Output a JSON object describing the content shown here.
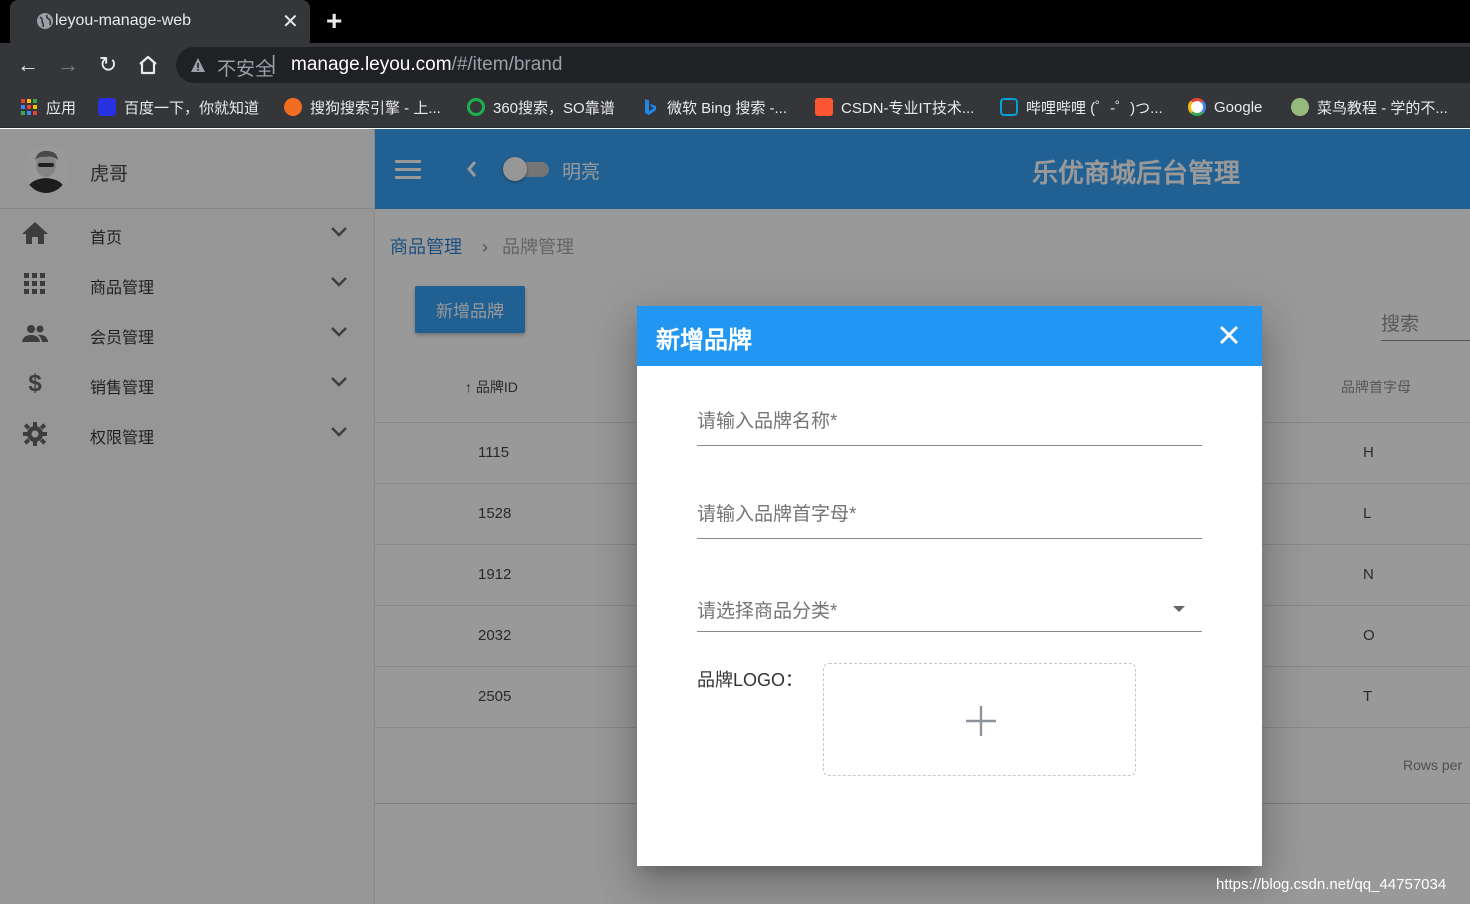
{
  "browser": {
    "tab_title": "leyou-manage-web",
    "insecure_label": "不安全",
    "url_host": "manage.leyou.com",
    "url_path": "/#/item/brand",
    "bookmarks": [
      {
        "label": "应用",
        "color": "#e53935"
      },
      {
        "label": "百度一下，你就知道",
        "color": "#2932e1"
      },
      {
        "label": "搜狗搜索引擎 - 上...",
        "color": "#f26d21"
      },
      {
        "label": "360搜索，SO靠谱",
        "color": "#1bb14b"
      },
      {
        "label": "微软 Bing 搜索 -...",
        "color": "#1e88e5"
      },
      {
        "label": "CSDN-专业IT技术...",
        "color": "#fc5531"
      },
      {
        "label": "哔哩哔哩 (゜-゜)つ...",
        "color": "#00a1d6"
      },
      {
        "label": "Google",
        "color": "#ffffff"
      },
      {
        "label": "菜鸟教程 - 学的不...",
        "color": "#96b97d"
      }
    ]
  },
  "sidebar": {
    "user_name": "虎哥",
    "items": [
      {
        "label": "首页",
        "icon": "home-icon"
      },
      {
        "label": "商品管理",
        "icon": "apps-icon"
      },
      {
        "label": "会员管理",
        "icon": "people-icon"
      },
      {
        "label": "销售管理",
        "icon": "dollar-icon"
      },
      {
        "label": "权限管理",
        "icon": "gear-icon"
      }
    ]
  },
  "topbar": {
    "theme_switch_label": "明亮",
    "title": "乐优商城后台管理"
  },
  "breadcrumb": {
    "parent": "商品管理",
    "current": "品牌管理"
  },
  "toolbar": {
    "add_brand_label": "新增品牌",
    "search_label": "搜索"
  },
  "table": {
    "col_id": "品牌ID",
    "col_letter": "品牌首字母",
    "rows": [
      {
        "id": "1115",
        "letter": "H"
      },
      {
        "id": "1528",
        "letter": "L"
      },
      {
        "id": "1912",
        "letter": "N"
      },
      {
        "id": "2032",
        "letter": "O"
      },
      {
        "id": "2505",
        "letter": "T"
      }
    ],
    "rows_per_page_label": "Rows per"
  },
  "dialog": {
    "title": "新增品牌",
    "name_placeholder": "请输入品牌名称*",
    "letter_placeholder": "请输入品牌首字母*",
    "category_placeholder": "请选择商品分类*",
    "logo_label": "品牌LOGO："
  },
  "watermark": "https://blog.csdn.net/qq_44757034",
  "colors": {
    "primary": "#2196f3",
    "link": "#1976d2"
  }
}
